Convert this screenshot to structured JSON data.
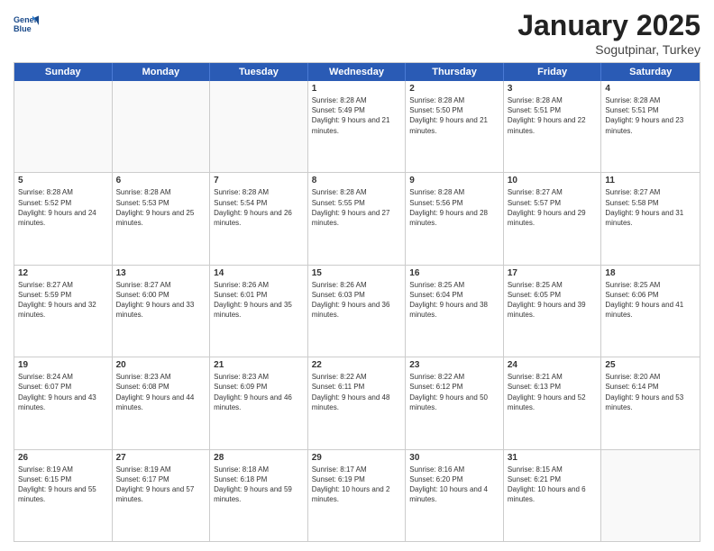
{
  "header": {
    "logo_line1": "General",
    "logo_line2": "Blue",
    "month": "January 2025",
    "location": "Sogutpinar, Turkey"
  },
  "day_headers": [
    "Sunday",
    "Monday",
    "Tuesday",
    "Wednesday",
    "Thursday",
    "Friday",
    "Saturday"
  ],
  "weeks": [
    [
      {
        "day": "",
        "empty": true
      },
      {
        "day": "",
        "empty": true
      },
      {
        "day": "",
        "empty": true
      },
      {
        "day": "1",
        "sunrise": "8:28 AM",
        "sunset": "5:49 PM",
        "daylight": "9 hours and 21 minutes."
      },
      {
        "day": "2",
        "sunrise": "8:28 AM",
        "sunset": "5:50 PM",
        "daylight": "9 hours and 21 minutes."
      },
      {
        "day": "3",
        "sunrise": "8:28 AM",
        "sunset": "5:51 PM",
        "daylight": "9 hours and 22 minutes."
      },
      {
        "day": "4",
        "sunrise": "8:28 AM",
        "sunset": "5:51 PM",
        "daylight": "9 hours and 23 minutes."
      }
    ],
    [
      {
        "day": "5",
        "sunrise": "8:28 AM",
        "sunset": "5:52 PM",
        "daylight": "9 hours and 24 minutes."
      },
      {
        "day": "6",
        "sunrise": "8:28 AM",
        "sunset": "5:53 PM",
        "daylight": "9 hours and 25 minutes."
      },
      {
        "day": "7",
        "sunrise": "8:28 AM",
        "sunset": "5:54 PM",
        "daylight": "9 hours and 26 minutes."
      },
      {
        "day": "8",
        "sunrise": "8:28 AM",
        "sunset": "5:55 PM",
        "daylight": "9 hours and 27 minutes."
      },
      {
        "day": "9",
        "sunrise": "8:28 AM",
        "sunset": "5:56 PM",
        "daylight": "9 hours and 28 minutes."
      },
      {
        "day": "10",
        "sunrise": "8:27 AM",
        "sunset": "5:57 PM",
        "daylight": "9 hours and 29 minutes."
      },
      {
        "day": "11",
        "sunrise": "8:27 AM",
        "sunset": "5:58 PM",
        "daylight": "9 hours and 31 minutes."
      }
    ],
    [
      {
        "day": "12",
        "sunrise": "8:27 AM",
        "sunset": "5:59 PM",
        "daylight": "9 hours and 32 minutes."
      },
      {
        "day": "13",
        "sunrise": "8:27 AM",
        "sunset": "6:00 PM",
        "daylight": "9 hours and 33 minutes."
      },
      {
        "day": "14",
        "sunrise": "8:26 AM",
        "sunset": "6:01 PM",
        "daylight": "9 hours and 35 minutes."
      },
      {
        "day": "15",
        "sunrise": "8:26 AM",
        "sunset": "6:03 PM",
        "daylight": "9 hours and 36 minutes."
      },
      {
        "day": "16",
        "sunrise": "8:25 AM",
        "sunset": "6:04 PM",
        "daylight": "9 hours and 38 minutes."
      },
      {
        "day": "17",
        "sunrise": "8:25 AM",
        "sunset": "6:05 PM",
        "daylight": "9 hours and 39 minutes."
      },
      {
        "day": "18",
        "sunrise": "8:25 AM",
        "sunset": "6:06 PM",
        "daylight": "9 hours and 41 minutes."
      }
    ],
    [
      {
        "day": "19",
        "sunrise": "8:24 AM",
        "sunset": "6:07 PM",
        "daylight": "9 hours and 43 minutes."
      },
      {
        "day": "20",
        "sunrise": "8:23 AM",
        "sunset": "6:08 PM",
        "daylight": "9 hours and 44 minutes."
      },
      {
        "day": "21",
        "sunrise": "8:23 AM",
        "sunset": "6:09 PM",
        "daylight": "9 hours and 46 minutes."
      },
      {
        "day": "22",
        "sunrise": "8:22 AM",
        "sunset": "6:11 PM",
        "daylight": "9 hours and 48 minutes."
      },
      {
        "day": "23",
        "sunrise": "8:22 AM",
        "sunset": "6:12 PM",
        "daylight": "9 hours and 50 minutes."
      },
      {
        "day": "24",
        "sunrise": "8:21 AM",
        "sunset": "6:13 PM",
        "daylight": "9 hours and 52 minutes."
      },
      {
        "day": "25",
        "sunrise": "8:20 AM",
        "sunset": "6:14 PM",
        "daylight": "9 hours and 53 minutes."
      }
    ],
    [
      {
        "day": "26",
        "sunrise": "8:19 AM",
        "sunset": "6:15 PM",
        "daylight": "9 hours and 55 minutes."
      },
      {
        "day": "27",
        "sunrise": "8:19 AM",
        "sunset": "6:17 PM",
        "daylight": "9 hours and 57 minutes."
      },
      {
        "day": "28",
        "sunrise": "8:18 AM",
        "sunset": "6:18 PM",
        "daylight": "9 hours and 59 minutes."
      },
      {
        "day": "29",
        "sunrise": "8:17 AM",
        "sunset": "6:19 PM",
        "daylight": "10 hours and 2 minutes."
      },
      {
        "day": "30",
        "sunrise": "8:16 AM",
        "sunset": "6:20 PM",
        "daylight": "10 hours and 4 minutes."
      },
      {
        "day": "31",
        "sunrise": "8:15 AM",
        "sunset": "6:21 PM",
        "daylight": "10 hours and 6 minutes."
      },
      {
        "day": "",
        "empty": true
      }
    ]
  ]
}
